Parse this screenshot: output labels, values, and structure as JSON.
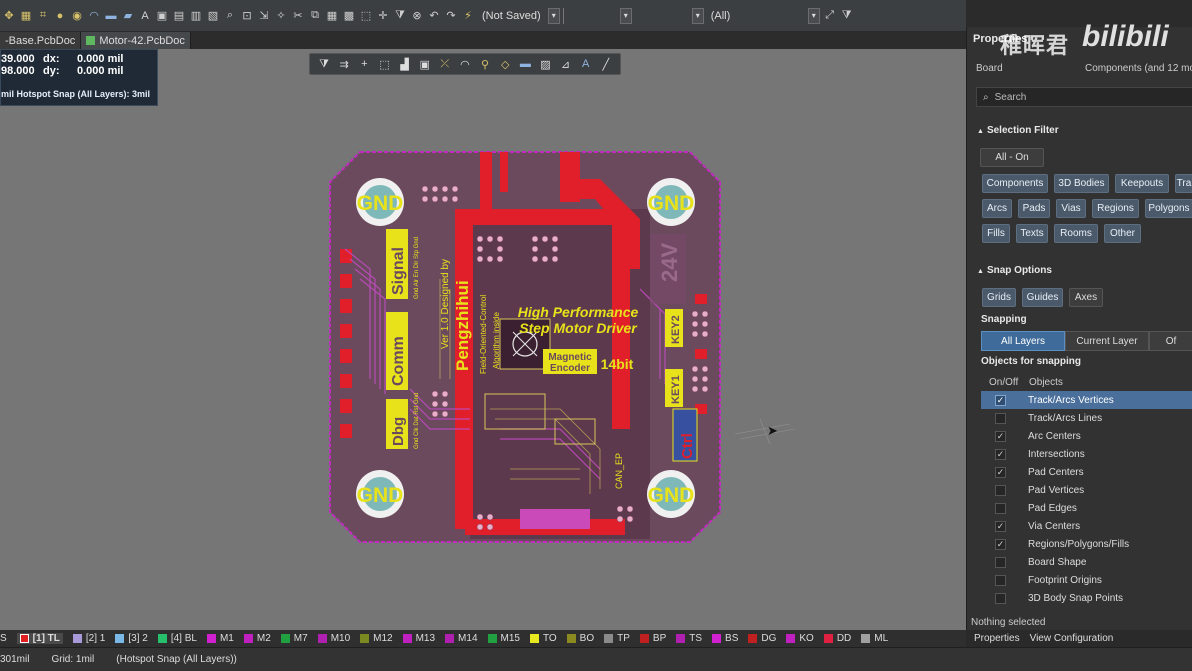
{
  "toolbar": {
    "not_saved": "(Not Saved)",
    "filter_all": "(All)"
  },
  "tabs": [
    {
      "label": "-Base.PcbDoc"
    },
    {
      "label": "Motor-42.PcbDoc"
    }
  ],
  "coords": {
    "x_val": "39.000",
    "y_val": "98.000",
    "dx_label": "dx:",
    "dx_val": "0.000 mil",
    "dy_label": "dy:",
    "dy_val": "0.000 mil",
    "hotspot": "mil Hotspot Snap (All Layers): 3mil"
  },
  "pcb": {
    "gnd": "GND",
    "signal": "Signal",
    "comm": "Comm",
    "dbg": "Dbg",
    "pengzhihui": "Pengzhihui",
    "designed_by": "Ver 1.0 Designed by",
    "foc": "Field-Oriented-Control",
    "algo": "Algorithm inside",
    "title1": "High Performance",
    "title2": "Step Motor Driver",
    "magnetic": "Magnetic",
    "encoder": "Encoder",
    "bit14": "14bit",
    "key1": "KEY1",
    "key2": "KEY2",
    "v24": "24V",
    "ctrl": "Ctrl",
    "can_ep": "CAN_EP",
    "pins": "Gnd Clk Dat Rst Gnd",
    "pins2": "Gnd Alr En Dir Stp Gnd"
  },
  "watermark": {
    "cn": "稚晖君",
    "logo": "bilibili"
  },
  "panel": {
    "title": "Properties",
    "board": "Board",
    "components_info": "Components (and 12 mo",
    "search_placeholder": "Search",
    "selection_filter": "Selection Filter",
    "all_on": "All - On",
    "filter_buttons": [
      "Components",
      "3D Bodies",
      "Keepouts",
      "Tra",
      "Arcs",
      "Pads",
      "Vias",
      "Regions",
      "Polygons",
      "Fills",
      "Texts",
      "Rooms",
      "Other"
    ],
    "snap_options": "Snap Options",
    "snap_buttons": [
      "Grids",
      "Guides",
      "Axes"
    ],
    "snapping": "Snapping",
    "snap_modes": [
      "All Layers",
      "Current Layer",
      "Of"
    ],
    "objects_for_snapping": "Objects for snapping",
    "col_onoff": "On/Off",
    "col_objects": "Objects",
    "objects": [
      {
        "label": "Track/Arcs Vertices",
        "checked": "✓"
      },
      {
        "label": "Track/Arcs Lines",
        "checked": ""
      },
      {
        "label": "Arc Centers",
        "checked": "✓"
      },
      {
        "label": "Intersections",
        "checked": "✓"
      },
      {
        "label": "Pad Centers",
        "checked": "✓"
      },
      {
        "label": "Pad Vertices",
        "checked": ""
      },
      {
        "label": "Pad Edges",
        "checked": ""
      },
      {
        "label": "Via Centers",
        "checked": "✓"
      },
      {
        "label": "Regions/Polygons/Fills",
        "checked": "✓"
      },
      {
        "label": "Board Shape",
        "checked": ""
      },
      {
        "label": "Footprint Origins",
        "checked": ""
      },
      {
        "label": "3D Body Snap Points",
        "checked": ""
      }
    ],
    "nothing_selected": "Nothing selected",
    "bottom_tabs": [
      "Properties",
      "View Configuration"
    ]
  },
  "layers": [
    {
      "label": "S",
      "color": "#888888"
    },
    {
      "label": "[1] TL",
      "color": "#e02020"
    },
    {
      "label": "[2] 1",
      "color": "#a89ad8"
    },
    {
      "label": "[3] 2",
      "color": "#7ab8e8"
    },
    {
      "label": "[4] BL",
      "color": "#26c06a"
    },
    {
      "label": "M1",
      "color": "#d020d0"
    },
    {
      "label": "M2",
      "color": "#c020c0"
    },
    {
      "label": "M7",
      "color": "#20a040"
    },
    {
      "label": "M10",
      "color": "#b020b0"
    },
    {
      "label": "M12",
      "color": "#7a8a20"
    },
    {
      "label": "M13",
      "color": "#c020c0"
    },
    {
      "label": "M14",
      "color": "#b020b0"
    },
    {
      "label": "M15",
      "color": "#20a040"
    },
    {
      "label": "TO",
      "color": "#e8e820"
    },
    {
      "label": "BO",
      "color": "#8a8a20"
    },
    {
      "label": "TP",
      "color": "#8a8a8a"
    },
    {
      "label": "BP",
      "color": "#c02020"
    },
    {
      "label": "TS",
      "color": "#b020b0"
    },
    {
      "label": "BS",
      "color": "#d020d0"
    },
    {
      "label": "DG",
      "color": "#c02020"
    },
    {
      "label": "KO",
      "color": "#c020c0"
    },
    {
      "label": "DD",
      "color": "#e02040"
    },
    {
      "label": "ML",
      "color": "#a0a0a0"
    }
  ],
  "status": {
    "pos": "301mil",
    "grid": "Grid: 1mil",
    "hotspot": "(Hotspot Snap (All Layers))"
  },
  "colors": {
    "board": "#6b4a5e",
    "copper_top": "#e01f2a",
    "silk": "#e8e21a",
    "outline": "#c429c4",
    "panel_bg": "#323232",
    "button": "#4b5a6a"
  }
}
